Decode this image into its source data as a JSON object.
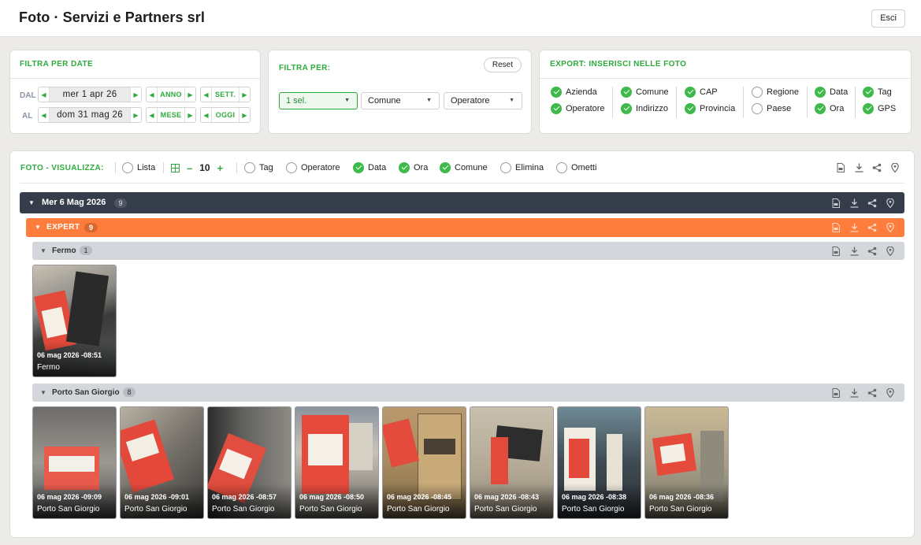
{
  "app": {
    "title": "Foto · Servizi e Partners srl",
    "exit_label": "Esci"
  },
  "date_filter": {
    "title": "FILTRA PER DATE",
    "from_label": "DAL",
    "to_label": "AL",
    "from_value": "mer 1 apr 26",
    "to_value": "dom 31 mag 26",
    "steps": {
      "year": "ANNO",
      "week": "SETT.",
      "month": "MESE",
      "today": "OGGI"
    }
  },
  "filter_by": {
    "title": "FILTRA PER:",
    "reset_label": "Reset",
    "selects": [
      "1 sel.",
      "Comune",
      "Operatore"
    ]
  },
  "export": {
    "title": "EXPORT: INSERISCI NELLE FOTO",
    "items": [
      {
        "label": "Azienda",
        "checked": true
      },
      {
        "label": "Operatore",
        "checked": true
      },
      {
        "label": "Comune",
        "checked": true
      },
      {
        "label": "Indirizzo",
        "checked": true
      },
      {
        "label": "CAP",
        "checked": true
      },
      {
        "label": "Provincia",
        "checked": true
      },
      {
        "label": "Regione",
        "checked": false
      },
      {
        "label": "Paese",
        "checked": false
      },
      {
        "label": "Data",
        "checked": true
      },
      {
        "label": "Ora",
        "checked": true
      },
      {
        "label": "Tag",
        "checked": true
      },
      {
        "label": "GPS",
        "checked": true
      }
    ]
  },
  "view": {
    "title": "FOTO - VISUALIZZA:",
    "list_label": "Lista",
    "grid_size": "10",
    "options": [
      {
        "label": "Tag",
        "checked": false
      },
      {
        "label": "Operatore",
        "checked": false
      },
      {
        "label": "Data",
        "checked": true
      },
      {
        "label": "Ora",
        "checked": true
      },
      {
        "label": "Comune",
        "checked": true
      },
      {
        "label": "Elimina",
        "checked": false
      },
      {
        "label": "Ometti",
        "checked": false
      }
    ]
  },
  "groups": {
    "day": {
      "label": "Mer 6 Mag 2026",
      "count": "9"
    },
    "operator": {
      "label": "EXPERT",
      "count": "9"
    },
    "sub1": {
      "label": "Fermo",
      "count": "1"
    },
    "sub2": {
      "label": "Porto San Giorgio",
      "count": "8"
    }
  },
  "photos_fermo": [
    {
      "time": "06 mag 2026 -08:51",
      "place": "Fermo"
    }
  ],
  "photos_psg": [
    {
      "time": "06 mag 2026 -09:09",
      "place": "Porto San Giorgio"
    },
    {
      "time": "06 mag 2026 -09:01",
      "place": "Porto San Giorgio"
    },
    {
      "time": "06 mag 2026 -08:57",
      "place": "Porto San Giorgio"
    },
    {
      "time": "06 mag 2026 -08:50",
      "place": "Porto San Giorgio"
    },
    {
      "time": "06 mag 2026 -08:45",
      "place": "Porto San Giorgio"
    },
    {
      "time": "06 mag 2026 -08:43",
      "place": "Porto San Giorgio"
    },
    {
      "time": "06 mag 2026 -08:38",
      "place": "Porto San Giorgio"
    },
    {
      "time": "06 mag 2026 -08:36",
      "place": "Porto San Giorgio"
    }
  ],
  "colors": {
    "accent": "#2eaa3c",
    "date_bar": "#363d4a",
    "expert_bar": "#ff7d3c",
    "sub_bar": "#d3d6db"
  }
}
